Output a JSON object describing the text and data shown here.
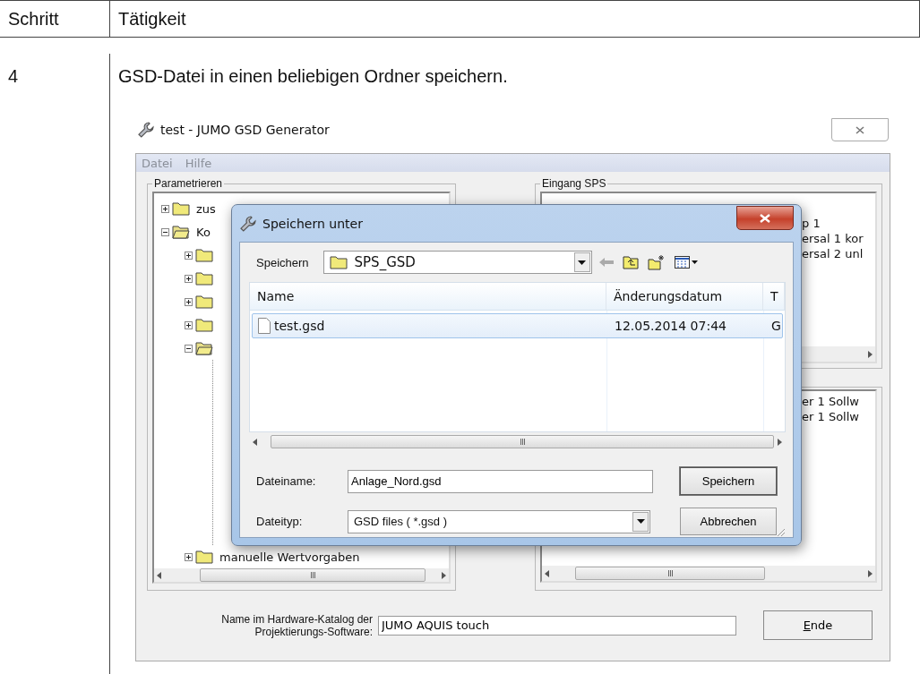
{
  "table": {
    "columns": [
      "Schritt",
      "Tätigkeit"
    ],
    "rows": [
      {
        "step": "4",
        "text": "GSD-Datei in einen beliebigen Ordner speichern."
      }
    ]
  },
  "app_window": {
    "title": "test - JUMO GSD Generator",
    "menu": [
      "Datei",
      "Hilfe"
    ],
    "parameter_group": {
      "label": "Parametrieren",
      "tree": [
        {
          "label": "zus",
          "expanded": false
        },
        {
          "label": "Ko",
          "expanded": true,
          "children": [
            {
              "expanded": false
            },
            {
              "expanded": false
            },
            {
              "expanded": false
            },
            {
              "expanded": false
            },
            {
              "expanded": true
            },
            {
              "label": "manuelle Wertvorgaben",
              "expanded": false
            }
          ]
        }
      ]
    },
    "input_group": {
      "label": "Eingang SPS",
      "lines": [
        "p 1",
        "ersal 1 kor",
        "ersal 2 unl"
      ]
    },
    "output_group": {
      "lines": [
        "er 1 Sollw",
        "er 1 Sollw"
      ]
    },
    "catalog_name": {
      "label": "Name im Hardware-Katalog der Projektierungs-Software:",
      "value": "JUMO AQUIS touch"
    },
    "end_button": "Ende"
  },
  "save_dialog": {
    "title": "Speichern unter",
    "location_label": "Speichern",
    "location": "SPS_GSD",
    "columns": [
      "Name",
      "Änderungsdatum",
      "T"
    ],
    "files": [
      {
        "name": "test.gsd",
        "date": "12.05.2014 07:44",
        "type": "G",
        "selected": true
      }
    ],
    "filename_label": "Dateiname:",
    "filename": "Anlage_Nord.gsd",
    "filetype_label": "Dateityp:",
    "filetype": "GSD files ( *.gsd )",
    "buttons": [
      "Speichern",
      "Abbrechen"
    ]
  }
}
